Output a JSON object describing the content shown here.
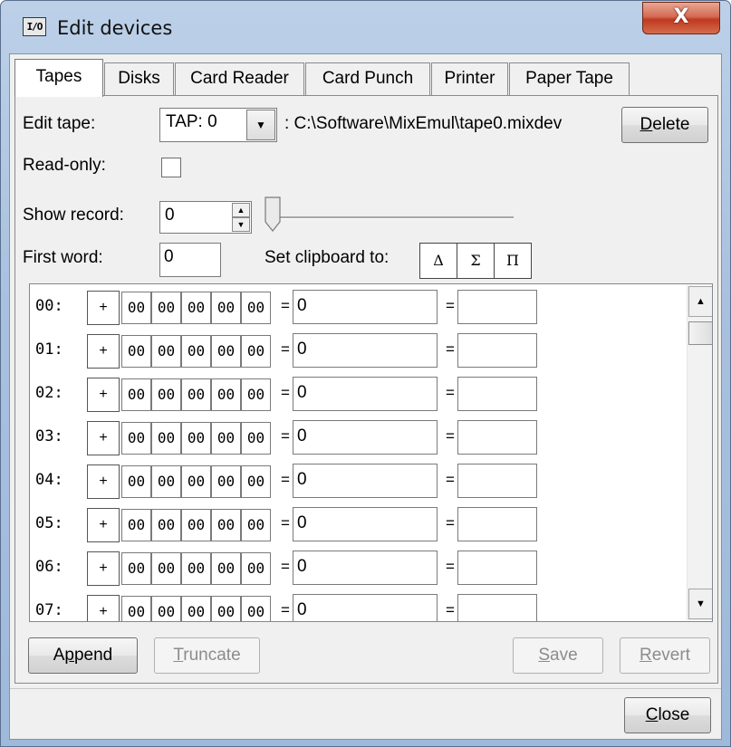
{
  "window": {
    "title": "Edit devices",
    "icon_text": "I/O",
    "close_glyph": "X"
  },
  "tabs": [
    {
      "label": "Tapes",
      "active": true
    },
    {
      "label": "Disks",
      "active": false
    },
    {
      "label": "Card Reader",
      "active": false
    },
    {
      "label": "Card Punch",
      "active": false
    },
    {
      "label": "Printer",
      "active": false
    },
    {
      "label": "Paper Tape",
      "active": false
    }
  ],
  "edit_tape": {
    "label": "Edit tape:",
    "selected": "TAP: 0",
    "path": ": C:\\Software\\MixEmul\\tape0.mixdev",
    "delete_label_first": "D",
    "delete_label_rest": "elete"
  },
  "read_only": {
    "label": "Read-only:",
    "checked": false
  },
  "show_record": {
    "label": "Show record:",
    "value": "0"
  },
  "first_word": {
    "label": "First word:",
    "value": "0"
  },
  "clipboard": {
    "label": "Set clipboard to:",
    "buttons": [
      {
        "symbol": "Δ"
      },
      {
        "symbol": "Σ"
      },
      {
        "symbol": "Π"
      }
    ]
  },
  "records": [
    {
      "label": "00:",
      "sign": "+",
      "bytes": [
        "00",
        "00",
        "00",
        "00",
        "00"
      ],
      "eq1": "=",
      "value": "0",
      "eq2": "=",
      "value2": ""
    },
    {
      "label": "01:",
      "sign": "+",
      "bytes": [
        "00",
        "00",
        "00",
        "00",
        "00"
      ],
      "eq1": "=",
      "value": "0",
      "eq2": "=",
      "value2": ""
    },
    {
      "label": "02:",
      "sign": "+",
      "bytes": [
        "00",
        "00",
        "00",
        "00",
        "00"
      ],
      "eq1": "=",
      "value": "0",
      "eq2": "=",
      "value2": ""
    },
    {
      "label": "03:",
      "sign": "+",
      "bytes": [
        "00",
        "00",
        "00",
        "00",
        "00"
      ],
      "eq1": "=",
      "value": "0",
      "eq2": "=",
      "value2": ""
    },
    {
      "label": "04:",
      "sign": "+",
      "bytes": [
        "00",
        "00",
        "00",
        "00",
        "00"
      ],
      "eq1": "=",
      "value": "0",
      "eq2": "=",
      "value2": ""
    },
    {
      "label": "05:",
      "sign": "+",
      "bytes": [
        "00",
        "00",
        "00",
        "00",
        "00"
      ],
      "eq1": "=",
      "value": "0",
      "eq2": "=",
      "value2": ""
    },
    {
      "label": "06:",
      "sign": "+",
      "bytes": [
        "00",
        "00",
        "00",
        "00",
        "00"
      ],
      "eq1": "=",
      "value": "0",
      "eq2": "=",
      "value2": ""
    },
    {
      "label": "07:",
      "sign": "+",
      "bytes": [
        "00",
        "00",
        "00",
        "00",
        "00"
      ],
      "eq1": "=",
      "value": "0",
      "eq2": "=",
      "value2": ""
    }
  ],
  "buttons": {
    "append": {
      "pre": "A",
      "ul": "p",
      "post": "pend"
    },
    "truncate": {
      "ul": "T",
      "post": "runcate"
    },
    "save": {
      "ul": "S",
      "post": "ave"
    },
    "revert": {
      "ul": "R",
      "post": "evert"
    },
    "close": {
      "ul": "C",
      "post": "lose"
    }
  },
  "colors": {
    "titlebar": "#a9c1df",
    "close_button": "#c0391f",
    "panel": "#f0f0f0"
  }
}
